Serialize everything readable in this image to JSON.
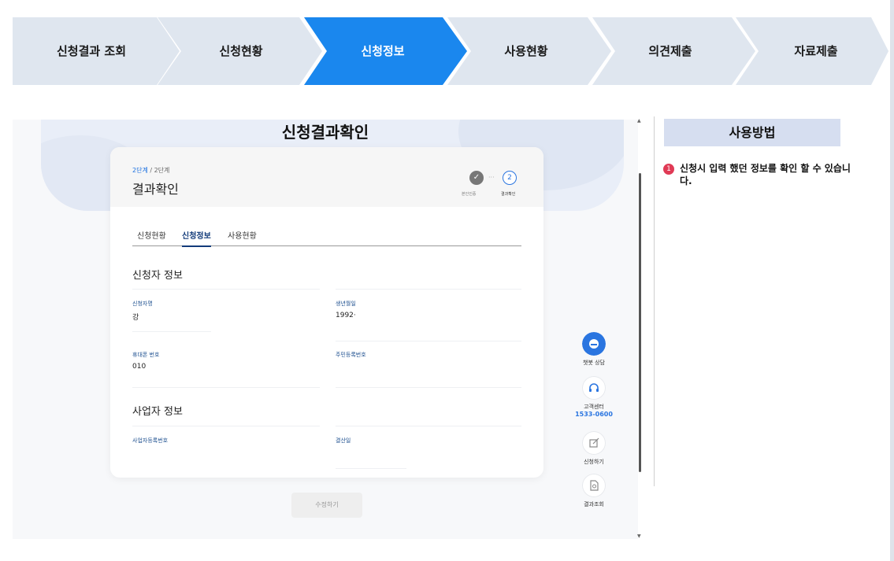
{
  "steps": [
    {
      "label": "신청결과 조회",
      "active": false
    },
    {
      "label": "신청현황",
      "active": false
    },
    {
      "label": "신청정보",
      "active": true
    },
    {
      "label": "사용현황",
      "active": false
    },
    {
      "label": "의견제출",
      "active": false
    },
    {
      "label": "자료제출",
      "active": false
    }
  ],
  "colors": {
    "step_active": "#1a87ee",
    "step_inactive": "#dfe6ef",
    "accent": "#2a75e0",
    "badge": "#e03a55"
  },
  "hero": {
    "title": "신청결과확인"
  },
  "card": {
    "step_current": "2단계",
    "step_total": " / 2단계",
    "title": "결과확인",
    "progress": {
      "step1_label": "본인인증",
      "step2_number": "2",
      "step2_label": "결과확인",
      "dash": "···"
    }
  },
  "tabs": [
    "신청현황",
    "신청정보",
    "사용현황"
  ],
  "applicant": {
    "section_title": "신청자 정보",
    "name_label": "신청자명",
    "name_value": "강",
    "birth_label": "생년월일",
    "birth_value": "1992·",
    "phone_label": "휴대폰 번호",
    "phone_value": "010",
    "rrn_label": "주민등록번호",
    "rrn_value": ""
  },
  "business": {
    "section_title": "사업자 정보",
    "reg_label": "사업자등록번호",
    "settle_label": "결산일"
  },
  "edit_button": "수정하기",
  "quick_menu": {
    "chatbot_label": "챗봇 상담",
    "center_label": "고객센터",
    "center_phone": "1533-0600",
    "apply_label": "신청하기",
    "result_label": "결과조회"
  },
  "howto": {
    "title": "사용방법",
    "items": [
      {
        "num": "1",
        "text": "신청시 입력 했던 정보를 확인 할 수 있습니다."
      }
    ]
  },
  "icons": [
    "check-icon",
    "chat-icon",
    "headset-icon",
    "edit-icon",
    "document-search-icon",
    "scroll-up-arrow-icon",
    "scroll-down-arrow-icon"
  ]
}
